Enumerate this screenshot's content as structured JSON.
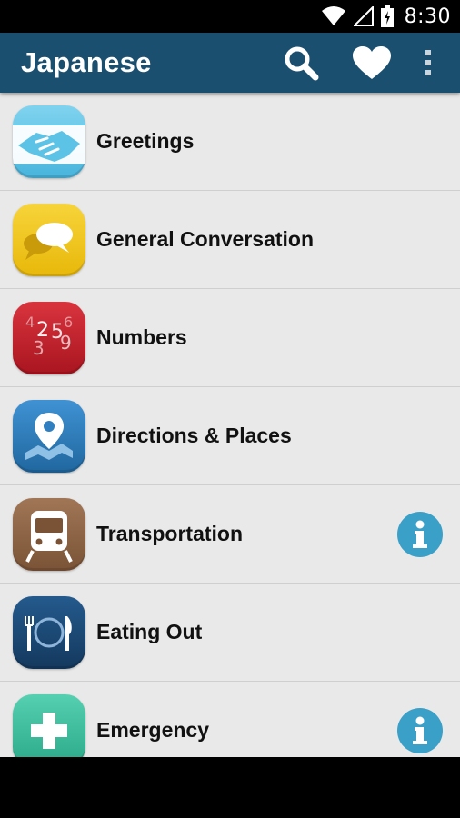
{
  "status": {
    "time": "8:30",
    "wifi_icon": "wifi-icon",
    "signal_icon": "signal-icon",
    "battery_icon": "battery-charging-icon"
  },
  "app_bar": {
    "title": "Japanese",
    "color": "#1b4f6f",
    "actions": [
      "search-icon",
      "heart-icon",
      "overflow-menu-icon"
    ]
  },
  "categories": [
    {
      "label": "Greetings",
      "icon": "handshake-icon",
      "color": "#5cc3e6",
      "info": false
    },
    {
      "label": "General Conversation",
      "icon": "speech-bubbles-icon",
      "color": "#f1c40f",
      "info": false
    },
    {
      "label": "Numbers",
      "icon": "numbers-icon",
      "color": "#c4242f",
      "info": false
    },
    {
      "label": "Directions & Places",
      "icon": "map-pin-icon",
      "color": "#2f7fc1",
      "info": false
    },
    {
      "label": "Transportation",
      "icon": "train-icon",
      "color": "#8c6445",
      "info": true
    },
    {
      "label": "Eating Out",
      "icon": "plate-fork-knife-icon",
      "color": "#1d4d7c",
      "info": false
    },
    {
      "label": "Emergency",
      "icon": "medical-cross-icon",
      "color": "#3fbf9f",
      "info": true
    }
  ],
  "numbers_icon_text": "2 5 9 6 4 3"
}
